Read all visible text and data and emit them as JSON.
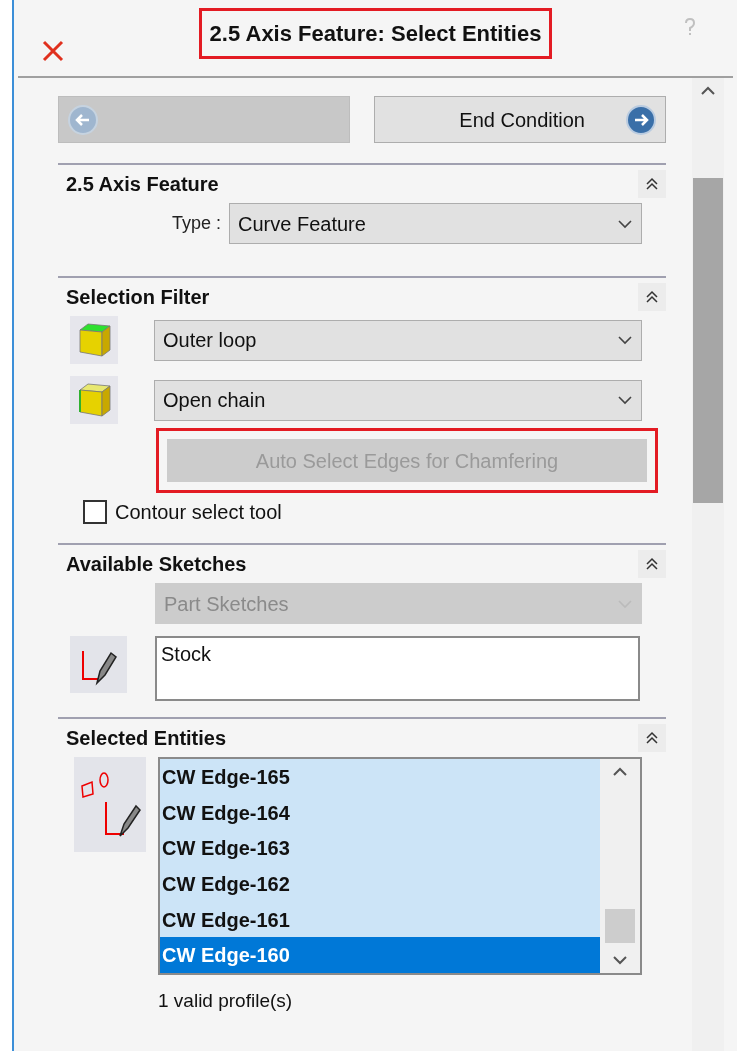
{
  "header": {
    "title": "2.5 Axis Feature: Select Entities",
    "title_annotated": true
  },
  "nav": {
    "back": {
      "disabled": true
    },
    "next": {
      "label": "End Condition",
      "disabled": false
    }
  },
  "sections": [
    {
      "kind": "type",
      "title": "2.5 Axis Feature",
      "type_label": "Type :",
      "type_value": "Curve Feature"
    },
    {
      "kind": "filter",
      "title": "Selection Filter",
      "filters": [
        {
          "value": "Outer loop"
        },
        {
          "value": "Open chain"
        }
      ],
      "auto_button": {
        "label": "Auto Select Edges for Chamfering",
        "disabled": true,
        "annotated": true
      },
      "contour": {
        "label": "Contour select tool",
        "checked": false
      }
    },
    {
      "kind": "sketches",
      "title": "Available Sketches",
      "source": {
        "value": "Part Sketches",
        "disabled": true
      },
      "list": [
        "Stock"
      ]
    },
    {
      "kind": "entities",
      "title": "Selected Entities",
      "items": [
        {
          "label": "CW Edge-165",
          "selected": false
        },
        {
          "label": "CW Edge-164",
          "selected": false
        },
        {
          "label": "CW Edge-163",
          "selected": false
        },
        {
          "label": "CW Edge-162",
          "selected": false
        },
        {
          "label": "CW Edge-161",
          "selected": false
        },
        {
          "label": "CW Edge-160",
          "selected": true
        }
      ],
      "status": "1 valid profile(s)"
    }
  ]
}
